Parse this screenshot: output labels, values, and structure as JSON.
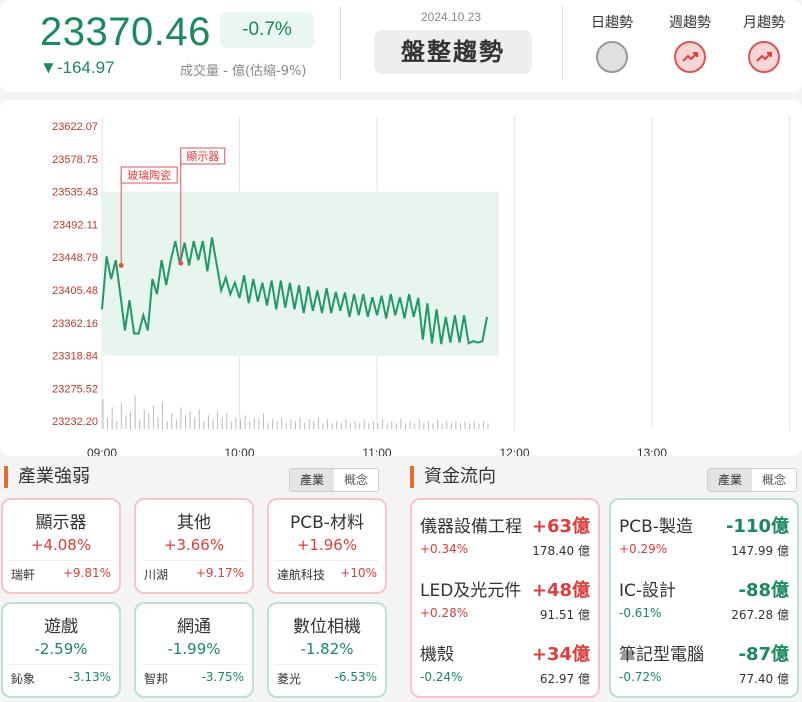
{
  "header": {
    "price": "23370.46",
    "pct": "-0.7%",
    "change": "▼-164.97",
    "volume": "成交量 - 億(估縮-9%)",
    "date": "2024.10.23",
    "trend_label": "盤整趨勢",
    "trends": [
      {
        "label": "日趨勢",
        "state": "neutral"
      },
      {
        "label": "週趨勢",
        "state": "up"
      },
      {
        "label": "月趨勢",
        "state": "up"
      }
    ]
  },
  "chart_data": {
    "type": "line",
    "y_ticks": [
      "23622.07",
      "23578.75",
      "23535.43",
      "23492.11",
      "23448.79",
      "23405.48",
      "23362.16",
      "23318.84",
      "23275.52",
      "23232.20"
    ],
    "x_ticks": [
      "09:00",
      "10:00",
      "11:00",
      "12:00",
      "13:00"
    ],
    "ylim": [
      23232.2,
      23622.07
    ],
    "shaded_band": [
      23318.84,
      23535.43
    ],
    "annotations": [
      {
        "label": "玻璃陶瓷",
        "time_min": 4,
        "value": 23438
      },
      {
        "label": "顯示器",
        "time_min": 30,
        "value": 23441
      }
    ],
    "series": [
      {
        "x_minutes": [
          0,
          2,
          4,
          6,
          8,
          10,
          12,
          14,
          16,
          18,
          20,
          22,
          24,
          26,
          28,
          30,
          32,
          34,
          36,
          38,
          40,
          42,
          44,
          46,
          48,
          50,
          52,
          54,
          56,
          58,
          60,
          62,
          64,
          66,
          68,
          70,
          72,
          74,
          76,
          78,
          80,
          82,
          84,
          86,
          88,
          90,
          92,
          94,
          96,
          98,
          100,
          102,
          104,
          106,
          108,
          110,
          112,
          114,
          116,
          118,
          120,
          122,
          124,
          126,
          128,
          130,
          132,
          134,
          136,
          138,
          140,
          142,
          144,
          146,
          148,
          150,
          152,
          154,
          156,
          158,
          160,
          162,
          164,
          166,
          168
        ],
        "values": [
          23380,
          23450,
          23420,
          23445,
          23400,
          23352,
          23392,
          23348,
          23348,
          23372,
          23352,
          23420,
          23400,
          23445,
          23412,
          23445,
          23470,
          23440,
          23468,
          23438,
          23470,
          23445,
          23470,
          23430,
          23475,
          23440,
          23405,
          23422,
          23400,
          23415,
          23395,
          23425,
          23388,
          23420,
          23390,
          23415,
          23385,
          23418,
          23380,
          23418,
          23382,
          23415,
          23380,
          23412,
          23375,
          23410,
          23378,
          23405,
          23375,
          23408,
          23375,
          23403,
          23378,
          23402,
          23370,
          23400,
          23372,
          23400,
          23370,
          23396,
          23372,
          23398,
          23368,
          23400,
          23372,
          23396,
          23368,
          23400,
          23370,
          23395,
          23340,
          23388,
          23335,
          23380,
          23334,
          23370,
          23336,
          23372,
          23336,
          23372,
          23335,
          23338,
          23336,
          23338,
          23370
        ]
      }
    ],
    "volume_bars": "per-minute volume histogram at bottom"
  },
  "industry": {
    "title": "產業強弱",
    "tabs": [
      "產業",
      "概念"
    ],
    "cards": [
      {
        "name": "顯示器",
        "pct": "+4.08%",
        "stock": "瑞軒",
        "spct": "+9.81%",
        "dir": "up"
      },
      {
        "name": "其他",
        "pct": "+3.66%",
        "stock": "川湖",
        "spct": "+9.17%",
        "dir": "up"
      },
      {
        "name": "PCB-材料",
        "pct": "+1.96%",
        "stock": "達航科技",
        "spct": "+10%",
        "dir": "up"
      },
      {
        "name": "遊戲",
        "pct": "-2.59%",
        "stock": "鈊象",
        "spct": "-3.13%",
        "dir": "dn"
      },
      {
        "name": "網通",
        "pct": "-1.99%",
        "stock": "智邦",
        "spct": "-3.75%",
        "dir": "dn"
      },
      {
        "name": "數位相機",
        "pct": "-1.82%",
        "stock": "菱光",
        "spct": "-6.53%",
        "dir": "dn"
      }
    ]
  },
  "flow": {
    "title": "資金流向",
    "tabs": [
      "產業",
      "概念"
    ],
    "inflow": [
      {
        "name": "儀器設備工程",
        "amt": "+63億",
        "pct": "+0.34%",
        "vol": "178.40 億"
      },
      {
        "name": "LED及光元件",
        "amt": "+48億",
        "pct": "+0.28%",
        "vol": "91.51 億"
      },
      {
        "name": "機殼",
        "amt": "+34億",
        "pct": "-0.24%",
        "vol": "62.97 億"
      }
    ],
    "outflow": [
      {
        "name": "PCB-製造",
        "amt": "-110億",
        "pct": "+0.29%",
        "vol": "147.99 億"
      },
      {
        "name": "IC-設計",
        "amt": "-88億",
        "pct": "-0.61%",
        "vol": "267.28 億"
      },
      {
        "name": "筆記型電腦",
        "amt": "-87億",
        "pct": "-0.72%",
        "vol": "77.40 億"
      }
    ]
  }
}
